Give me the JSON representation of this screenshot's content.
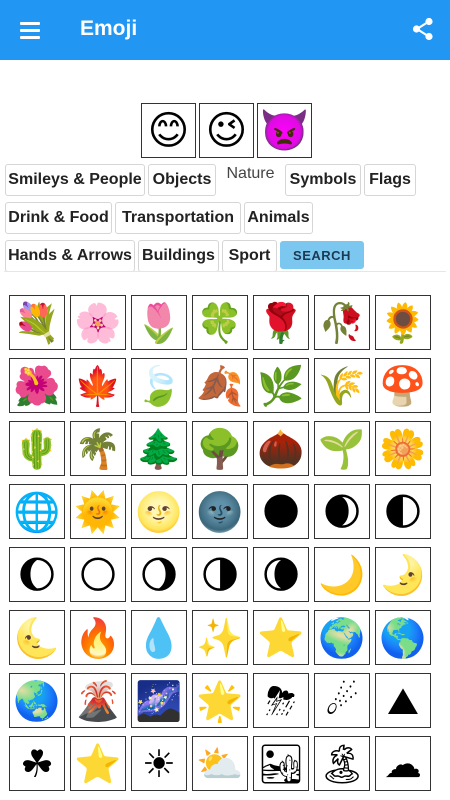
{
  "appbar": {
    "title": "Emoji",
    "menu_icon": "hamburger-menu-icon",
    "share_icon": "share-icon",
    "color": "#2196f3"
  },
  "preview": [
    "😊",
    "😉",
    "👿"
  ],
  "categories": {
    "smileys": "Smileys & People",
    "objects": "Objects",
    "nature": "Nature",
    "symbols": "Symbols",
    "flags": "Flags",
    "drink": "Drink & Food",
    "transport": "Transportation",
    "animals": "Animals",
    "hands": "Hands & Arrows",
    "buildings": "Buildings",
    "sport": "Sport",
    "search": "SEARCH",
    "active": "Nature"
  },
  "emojis": [
    "💐",
    "🌸",
    "🌷",
    "🍀",
    "🌹",
    "🥀",
    "🌻",
    "🌺",
    "🍁",
    "🍃",
    "🍂",
    "🌿",
    "🌾",
    "🍄",
    "🌵",
    "🌴",
    "🌲",
    "🌳",
    "🌰",
    "🌱",
    "🌼",
    "🌐",
    "🌞",
    "🌝",
    "🌚",
    "🌑",
    "🌒",
    "🌓",
    "🌔",
    "🌕",
    "🌖",
    "🌗",
    "🌘",
    "🌙",
    "🌛",
    "🌜",
    "🔥",
    "💧",
    "✨",
    "⭐",
    "🌍",
    "🌎",
    "🌏",
    "🌋",
    "🌌",
    "🌟",
    "⛈",
    "☄",
    "⛰",
    "☘",
    "⭐",
    "☀",
    "⛅",
    "🏜",
    "🏝",
    "☁"
  ]
}
